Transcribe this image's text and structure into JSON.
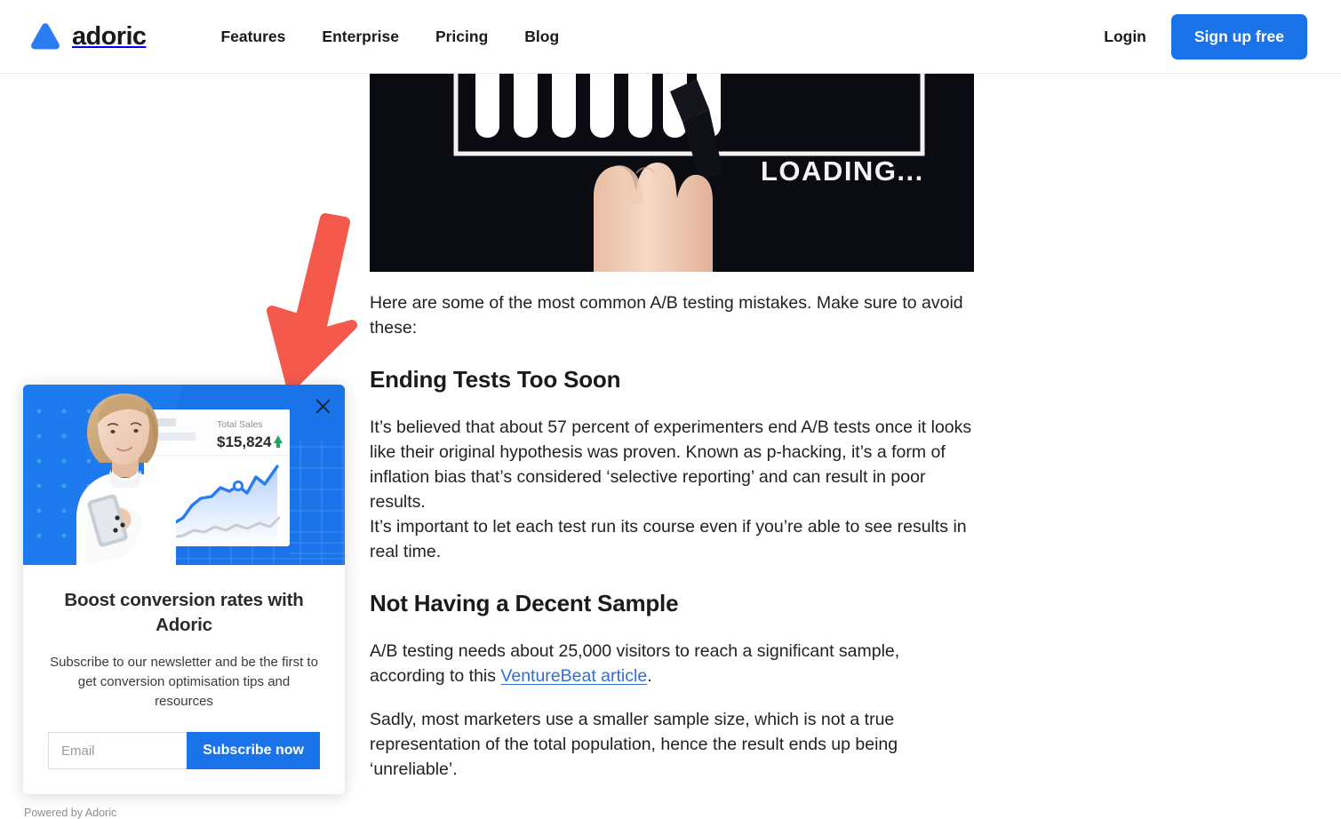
{
  "header": {
    "brand": {
      "name": "adoric",
      "logo_icon": "adoric-triangle-logo",
      "logo_color": "#2b7cf0"
    },
    "nav": [
      {
        "label": "Features"
      },
      {
        "label": "Enterprise"
      },
      {
        "label": "Pricing"
      },
      {
        "label": "Blog"
      }
    ],
    "login_label": "Login",
    "signup_label": "Sign up free",
    "signup_color": "#1a73e8"
  },
  "article": {
    "hero_image": {
      "alt": "hand drawing a loading bar on a dark background",
      "caption_text": "LOADING...",
      "background": "#0b0b12"
    },
    "blocks": [
      {
        "type": "p",
        "text": "Here are some of the most common A/B testing mistakes. Make sure to avoid these:"
      },
      {
        "type": "h2",
        "text": "Ending Tests Too Soon"
      },
      {
        "type": "p",
        "text": "It’s believed that about 57 percent of experimenters end A/B tests once it looks like their original hypothesis was proven. Known as p-hacking, it’s a form of inflation bias that’s considered ‘selective reporting’ and can result in poor results."
      },
      {
        "type": "p",
        "text": "It’s important to let each test run its course even if you’re able to see results in real time."
      },
      {
        "type": "h2",
        "text": "Not Having a Decent Sample"
      },
      {
        "type": "p_link",
        "before": "A/B testing needs about 25,000 visitors to reach a significant sample, according to this ",
        "link": "VentureBeat article",
        "after": "."
      },
      {
        "type": "p",
        "text": "Sadly, most marketers use a smaller sample size, which is not a true representation of the total population, hence the result ends up being ‘unreliable’."
      }
    ]
  },
  "annotation": {
    "arrow_icon": "red-down-left-arrow",
    "arrow_color": "#f4594b"
  },
  "popup": {
    "close_icon": "close-icon",
    "visual": {
      "background_color": "#1a73e8",
      "stat_label": "Total Sales",
      "stat_value": "$15,824",
      "trend_icon": "up-arrow-icon",
      "trend_color": "#22a45d",
      "alt": "woman holding a phone in front of a sales dashboard chart"
    },
    "title": "Boost conversion rates with Adoric",
    "subtitle": "Subscribe to our newsletter and be the first to get conversion optimisation tips and resources",
    "email_placeholder": "Email",
    "email_value": "",
    "subscribe_label": "Subscribe now",
    "powered_by": "Powered by Adoric"
  }
}
